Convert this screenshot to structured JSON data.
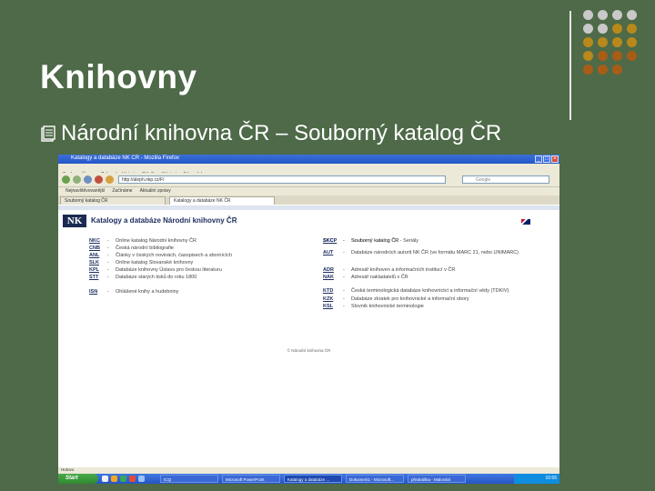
{
  "slide": {
    "title": "Knihovny",
    "bullet": "Národní knihovna ČR – Souborný katalog ČR"
  },
  "colors": {
    "background": "#4e6a48",
    "dots": [
      "#c9c9c9",
      "#c9c9c9",
      "#c9c9c9",
      "#c9c9c9",
      "#b8891a",
      "#b8891a",
      "#b8891a",
      "#b8891a",
      "#b8891a",
      "#a85d16",
      "#a85d16",
      "#a85d16",
      "#a85d16",
      "#a85d16",
      "#a85d16"
    ]
  },
  "browser": {
    "title": "Katalogy a databáze NK ČR - Mozilla Firefox",
    "menu": [
      "Soubor",
      "Úpravy",
      "Zobrazit",
      "Historie",
      "Záložky",
      "Nástroje",
      "Nápověda"
    ],
    "url": "http://aleph.nkp.cz/F/",
    "search_placeholder": "Google",
    "bookmarks": [
      "Nejnavštěvovanější",
      "Začínáme",
      "Aktuální zprávy"
    ],
    "tabs": [
      {
        "label": "Souborný katalog ČR",
        "active": false
      },
      {
        "label": "Katalogy a databáze NK ČR",
        "active": true
      }
    ],
    "status": "Hotovo"
  },
  "page": {
    "logo": "NK",
    "site_title": "Katalogy a databáze Národní knihovny ČR",
    "left_entries": [
      {
        "code": "NKC",
        "desc": "Online katalog Národní knihovny ČR"
      },
      {
        "code": "CNB",
        "desc": "Česká národní bibliografie"
      },
      {
        "code": "ANL",
        "desc": "Články v českých novinách, časopisech a sbornících"
      },
      {
        "code": "SLK",
        "desc": "Online katalog Slovanské knihovny"
      },
      {
        "code": "KPL",
        "desc": "Databáze knihovny Ústavu pro českou literaturu"
      },
      {
        "code": "STT",
        "desc": "Databáze starých tisků do roku 1800"
      },
      {
        "code": "ISN",
        "desc": "Ohlášené knihy a hudebniny"
      }
    ],
    "right_entries": [
      {
        "code": "SKC",
        "desc": "Souborný katalog ČR"
      },
      {
        "code": "SKCP",
        "desc": "Souborný katalog ČR - Seriály"
      },
      {
        "code": "AUT",
        "desc": "Databáze národních autorit NK ČR (ve formátu MARC 21, nebo UNIMARC)"
      },
      {
        "code": "ADR",
        "desc": "Adresář knihoven a informačních institucí v ČR"
      },
      {
        "code": "NAK",
        "desc": "Adresář nakladatelů v ČR"
      },
      {
        "code": "KTD",
        "desc": "Česká terminologická databáze knihovnictví a informační vědy (TDKIV)"
      },
      {
        "code": "KZK",
        "desc": "Databáze zkratek pro knihovnické a informační obory"
      },
      {
        "code": "KSL",
        "desc": "Slovník knihovnické terminologie"
      }
    ],
    "copyright": "© Národní knihovna ČR"
  },
  "taskbar": {
    "start": "Start",
    "items": [
      {
        "label": "ICQ",
        "active": false
      },
      {
        "label": "Microsoft PowerPoint",
        "active": false
      },
      {
        "label": "Katalogy a databáze ...",
        "active": true
      },
      {
        "label": "Dokument1 - Microsoft...",
        "active": false
      },
      {
        "label": "přednáška - Malování",
        "active": false
      }
    ],
    "clock": "10:56"
  }
}
